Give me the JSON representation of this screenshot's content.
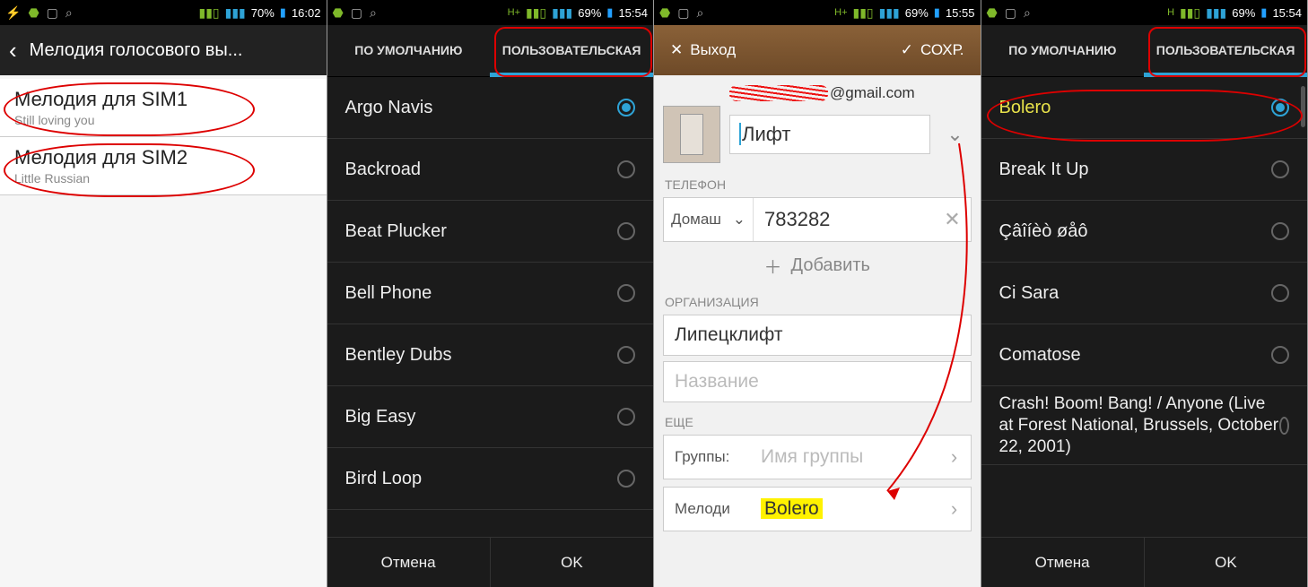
{
  "screen1": {
    "status": {
      "battery": "70%",
      "time": "16:02"
    },
    "title": "Мелодия голосового вы...",
    "items": [
      {
        "title": "Мелодия для SIM1",
        "subtitle": "Still loving you"
      },
      {
        "title": "Мелодия для SIM2",
        "subtitle": "Little Russian"
      }
    ]
  },
  "screen2": {
    "status": {
      "battery": "69%",
      "time": "15:54"
    },
    "tabs": {
      "default": "ПО УМОЛЧАНИЮ",
      "custom": "ПОЛЬЗОВАТЕЛЬСКАЯ"
    },
    "ringtones": [
      "Argo Navis",
      "Backroad",
      "Beat Plucker",
      "Bell Phone",
      "Bentley Dubs",
      "Big Easy",
      "Bird Loop"
    ],
    "selected_index": 0,
    "buttons": {
      "cancel": "Отмена",
      "ok": "OK"
    }
  },
  "screen3": {
    "status": {
      "battery": "69%",
      "time": "15:55"
    },
    "toolbar": {
      "exit": "Выход",
      "save": "СОХР."
    },
    "email_suffix": "@gmail.com",
    "contact_name": "Лифт",
    "sections": {
      "phone": "ТЕЛЕФОН",
      "org": "ОРГАНИЗАЦИЯ",
      "more": "ЕЩЕ"
    },
    "phone": {
      "type": "Домаш",
      "number": "783282"
    },
    "add_label": "Добавить",
    "org_value": "Липецклифт",
    "org_placeholder": "Название",
    "groups": {
      "label": "Группы:",
      "placeholder": "Имя группы"
    },
    "melody": {
      "label": "Мелоди",
      "value": "Bolero"
    }
  },
  "screen4": {
    "status": {
      "battery": "69%",
      "time": "15:54"
    },
    "tabs": {
      "default": "ПО УМОЛЧАНИЮ",
      "custom": "ПОЛЬЗОВАТЕЛЬСКАЯ"
    },
    "ringtones": [
      "Bolero",
      "Break It Up",
      "Çâîíèò øåô",
      "Ci Sara",
      "Comatose",
      "Crash! Boom! Bang! / Anyone (Live at Forest National, Brussels, October 22, 2001)"
    ],
    "selected_index": 0,
    "buttons": {
      "cancel": "Отмена",
      "ok": "OK"
    }
  }
}
